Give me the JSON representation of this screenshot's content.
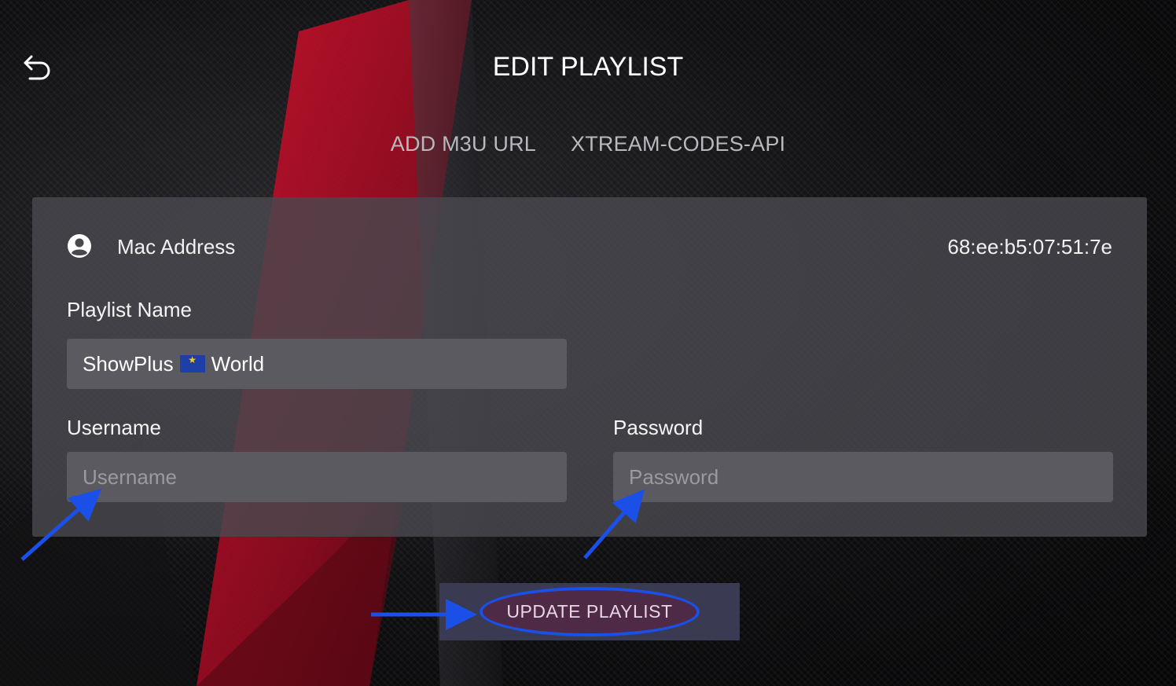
{
  "header": {
    "title": "EDIT PLAYLIST",
    "back_icon": "undo-arrow-icon"
  },
  "tabs": [
    {
      "label": "ADD M3U URL"
    },
    {
      "label": "XTREAM-CODES-API"
    }
  ],
  "form": {
    "mac": {
      "icon": "account-circle-icon",
      "label": "Mac Address",
      "value": "68:ee:b5:07:51:7e"
    },
    "playlist_name": {
      "label": "Playlist Name",
      "value_prefix": "ShowPlus",
      "flag_icon": "eu-flag-icon",
      "value_suffix": "World"
    },
    "username": {
      "label": "Username",
      "value": "",
      "placeholder": "Username"
    },
    "password": {
      "label": "Password",
      "value": "",
      "placeholder": "Password"
    },
    "submit_label": "UPDATE PLAYLIST"
  },
  "annotations": {
    "arrow_color": "#1a4fe8",
    "highlight_color": "#1a4fe8"
  },
  "colors": {
    "panel": "#48484e",
    "input": "#5a5a60",
    "button": "#3a3a52",
    "accent_red": "#b0102a"
  }
}
